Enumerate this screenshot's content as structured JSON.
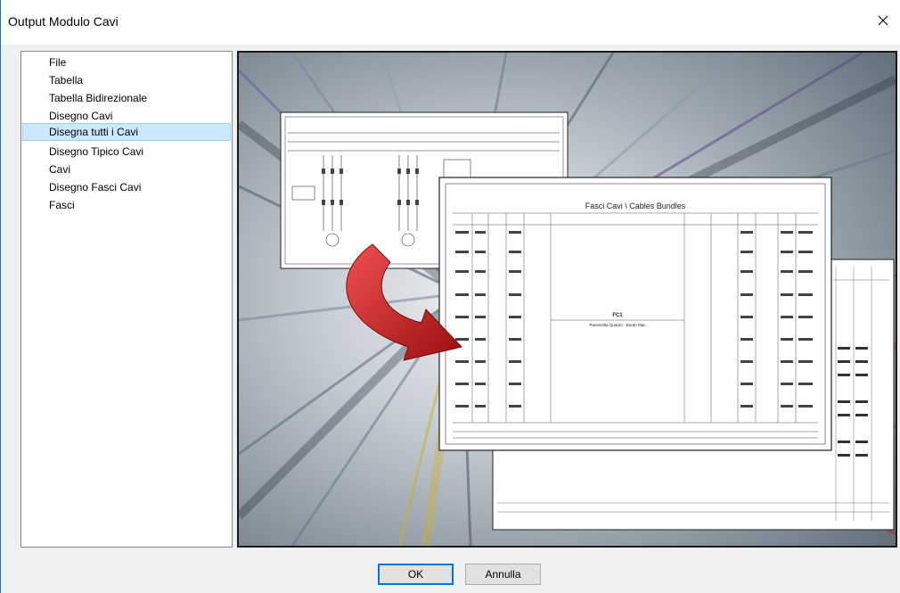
{
  "window": {
    "title": "Output Modulo Cavi"
  },
  "icons": {
    "close": "close-icon",
    "arrow": "red-arrow-icon"
  },
  "list": {
    "items": [
      {
        "label": "File",
        "selected": false
      },
      {
        "label": "Tabella",
        "selected": false
      },
      {
        "label": "Tabella Bidirezionale",
        "selected": false
      },
      {
        "label": "Disegno Cavi",
        "selected": false
      },
      {
        "label": "Disegna tutti i Cavi",
        "selected": true
      },
      {
        "label": "Disegno Tipico Cavi",
        "selected": false
      },
      {
        "label": "Cavi",
        "selected": false
      },
      {
        "label": "Disegno Fasci Cavi",
        "selected": false
      },
      {
        "label": "Fasci",
        "selected": false
      }
    ]
  },
  "preview": {
    "sheet_title": "Fasci Cavi \\ Cables Bundles",
    "bundle_label": "FC1",
    "bundle_sub": "Passerella Quadro - Bordo Mac"
  },
  "buttons": {
    "ok": "OK",
    "cancel": "Annulla"
  },
  "colors": {
    "selection": "#cce8ff",
    "accent": "#0078d7",
    "arrow": "#d42020"
  }
}
